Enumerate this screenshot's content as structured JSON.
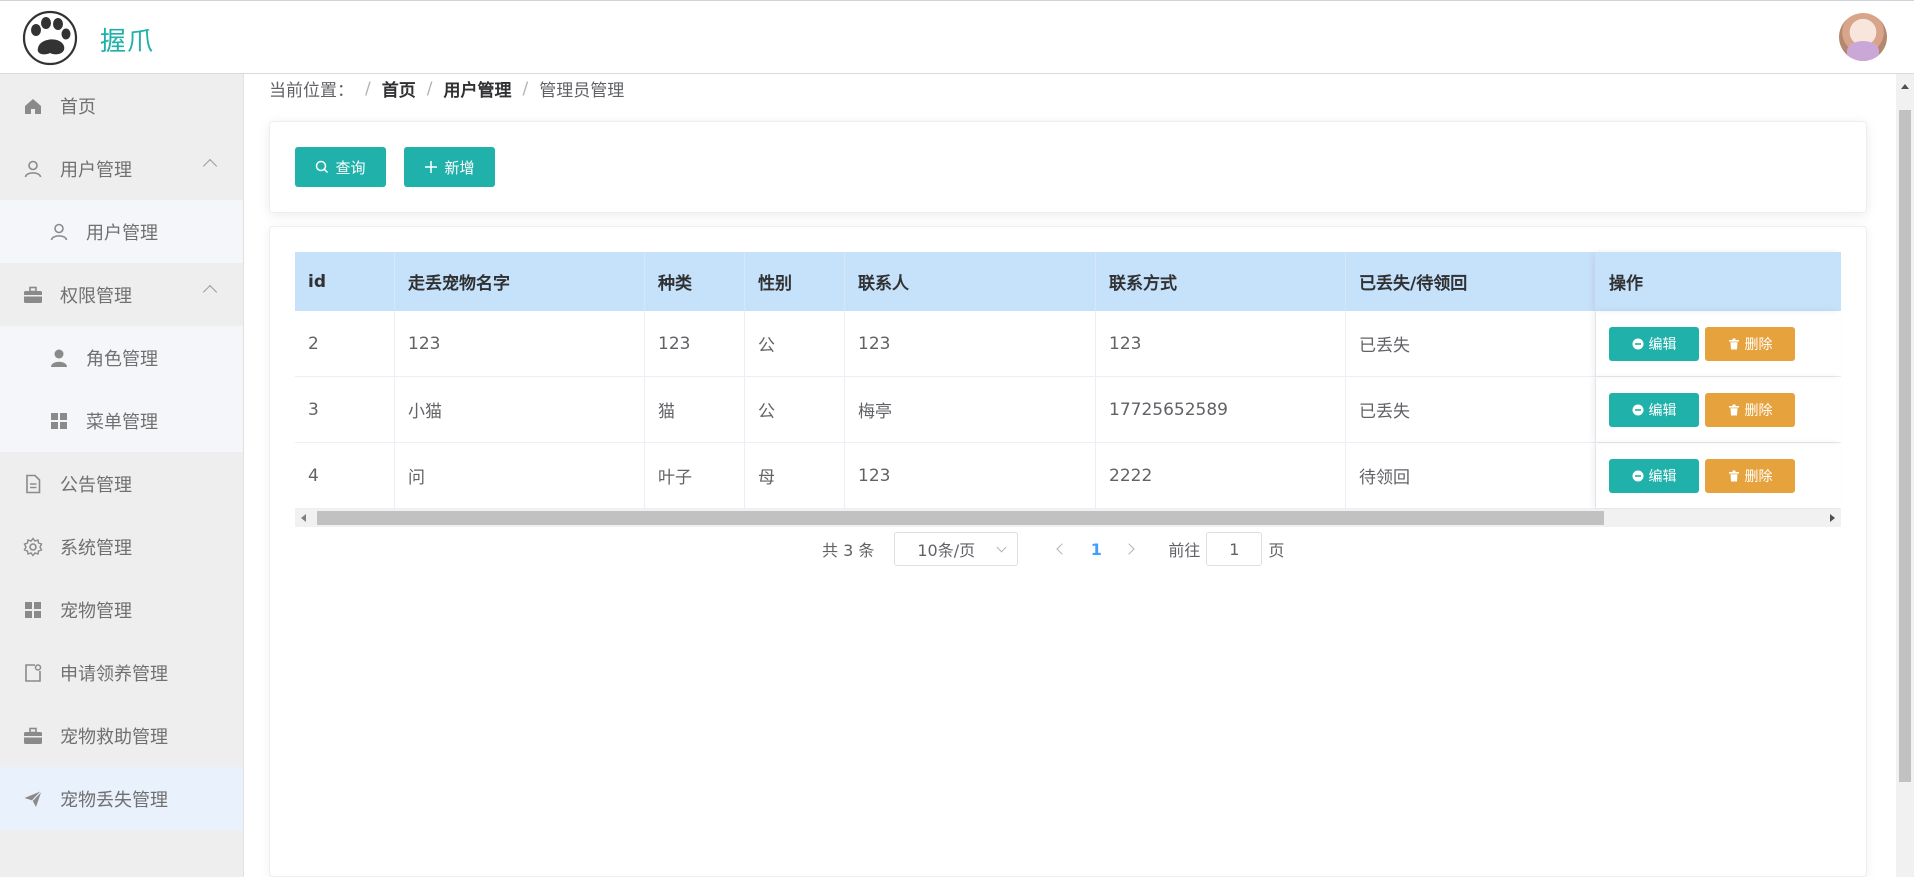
{
  "header": {
    "brand": "握爪"
  },
  "sidebar": {
    "items": [
      {
        "label": "首页",
        "icon": "home-icon"
      },
      {
        "label": "用户管理",
        "icon": "user-icon",
        "expanded": true,
        "children": [
          {
            "label": "用户管理",
            "icon": "user-icon"
          }
        ]
      },
      {
        "label": "权限管理",
        "icon": "briefcase-icon",
        "expanded": true,
        "children": [
          {
            "label": "角色管理",
            "icon": "person-icon"
          },
          {
            "label": "菜单管理",
            "icon": "grid-icon"
          }
        ]
      },
      {
        "label": "公告管理",
        "icon": "document-icon"
      },
      {
        "label": "系统管理",
        "icon": "gear-icon"
      },
      {
        "label": "宠物管理",
        "icon": "grid-icon"
      },
      {
        "label": "申请领养管理",
        "icon": "note-icon"
      },
      {
        "label": "宠物救助管理",
        "icon": "briefcase-icon"
      },
      {
        "label": "宠物丢失管理",
        "icon": "send-icon",
        "active": true
      }
    ]
  },
  "breadcrumb": {
    "prefix": "当前位置：",
    "items": [
      "首页",
      "用户管理",
      "管理员管理"
    ]
  },
  "toolbar": {
    "query_label": "查询",
    "add_label": "新增"
  },
  "table": {
    "columns": [
      "id",
      "走丢宠物名字",
      "种类",
      "性别",
      "联系人",
      "联系方式",
      "已丢失/待领回",
      "操作"
    ],
    "rows": [
      [
        "2",
        "123",
        "123",
        "公",
        "123",
        "123",
        "已丢失"
      ],
      [
        "3",
        "小猫",
        "猫",
        "公",
        "梅亭",
        "17725652589",
        "已丢失"
      ],
      [
        "4",
        "问",
        "叶子",
        "母",
        "123",
        "2222",
        "待领回"
      ]
    ],
    "edit_label": "编辑",
    "delete_label": "删除"
  },
  "pagination": {
    "total_text": "共 3 条",
    "page_size": "10条/页",
    "current_page": "1",
    "goto_label": "前往",
    "goto_value": "1",
    "page_suffix": "页"
  },
  "colors": {
    "primary": "#20b2aa",
    "warning": "#e6a23c",
    "header_bg": "#c6e1fa",
    "link": "#409eff"
  }
}
